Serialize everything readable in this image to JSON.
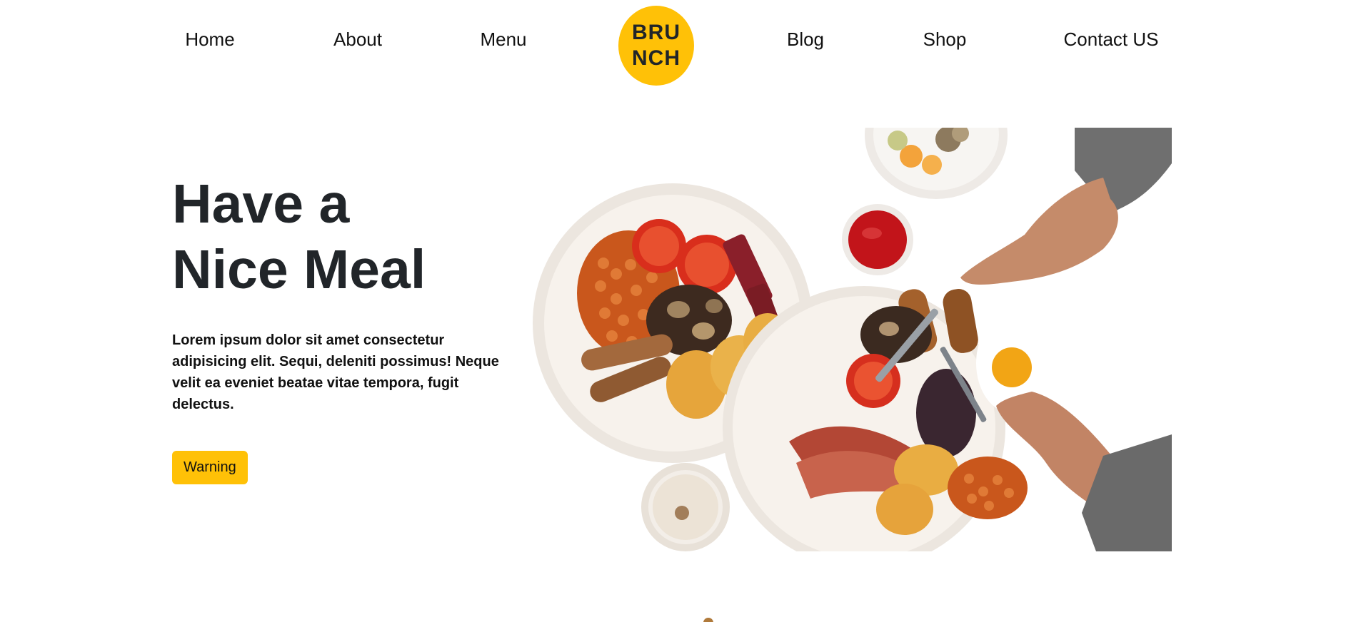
{
  "nav": {
    "items_left": [
      "Home",
      "About",
      "Menu"
    ],
    "logo": {
      "line1": "BRU",
      "line2": "NCH"
    },
    "items_right": [
      "Blog",
      "Shop",
      "Contact US"
    ]
  },
  "hero": {
    "title_line1": "Have a",
    "title_line2": "Nice Meal",
    "description": "Lorem ipsum dolor sit amet consectetur adipisicing elit. Sequi, deleniti possimus! Neque velit ea eveniet beatae vitae tempora, fugit delectus.",
    "button_label": "Warning"
  },
  "colors": {
    "accent": "#ffc107",
    "text": "#212529",
    "background": "#ffffff"
  }
}
